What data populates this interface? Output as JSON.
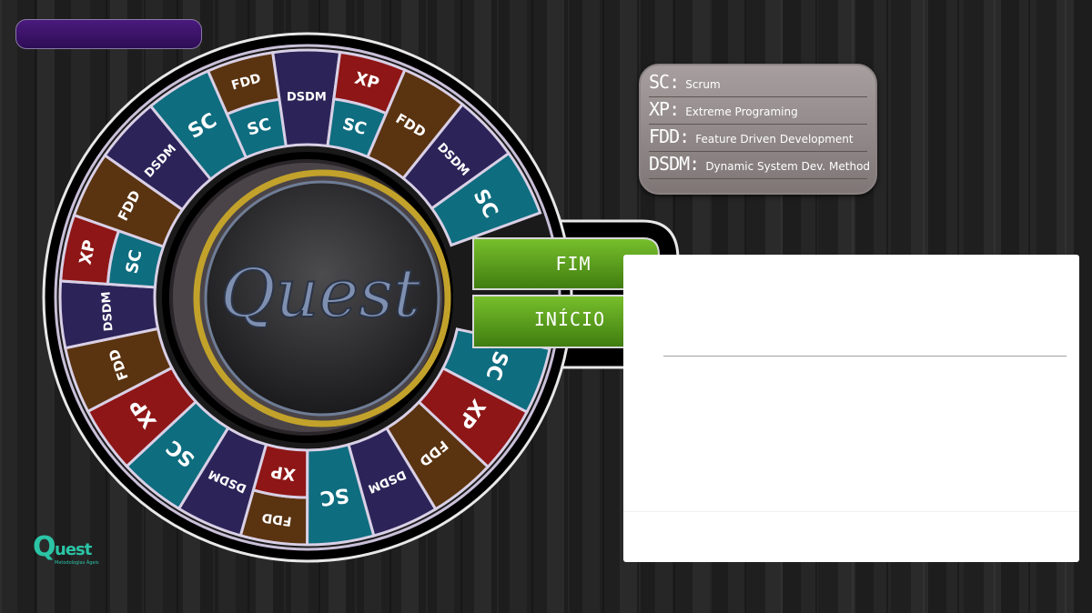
{
  "player": {
    "name": ""
  },
  "legend": [
    {
      "abbr": "SC:",
      "desc": "Scrum"
    },
    {
      "abbr": "XP:",
      "desc": "Extreme Programing"
    },
    {
      "abbr": "FDD:",
      "desc": "Feature Driven Development"
    },
    {
      "abbr": "DSDM:",
      "desc": "Dynamic System Dev. Method"
    }
  ],
  "board": {
    "center_title": "Quest",
    "end_label": "FIM",
    "start_label": "INÍCIO",
    "segments": [
      {
        "label": "SC"
      },
      {
        "label": "XP"
      },
      {
        "label": "FDD"
      },
      {
        "label": "DSDM"
      },
      {
        "label": "SC"
      },
      {
        "label": "FDD / XP"
      },
      {
        "label": "DSDM"
      },
      {
        "label": "SC"
      },
      {
        "label": "XP"
      },
      {
        "label": "FDD"
      },
      {
        "label": "DSDM"
      },
      {
        "label": "XP / SC"
      },
      {
        "label": "FDD"
      },
      {
        "label": "DSDM"
      },
      {
        "label": "SC"
      },
      {
        "label": "FDD / SC"
      },
      {
        "label": "DSDM"
      },
      {
        "label": "XP / SC"
      },
      {
        "label": "FDD"
      },
      {
        "label": "DSDM"
      },
      {
        "label": "SC"
      }
    ]
  },
  "question": {
    "text": ""
  },
  "logo": {
    "name": "Quest",
    "subtitle": "Metodologias Ágeis"
  },
  "colors": {
    "SC": "#0e6d7f",
    "XP": "#8e1616",
    "FDD": "#5a3310",
    "DSDM": "#2c2458",
    "button_green": "#5ea41f",
    "gold": "#c2a22a"
  }
}
